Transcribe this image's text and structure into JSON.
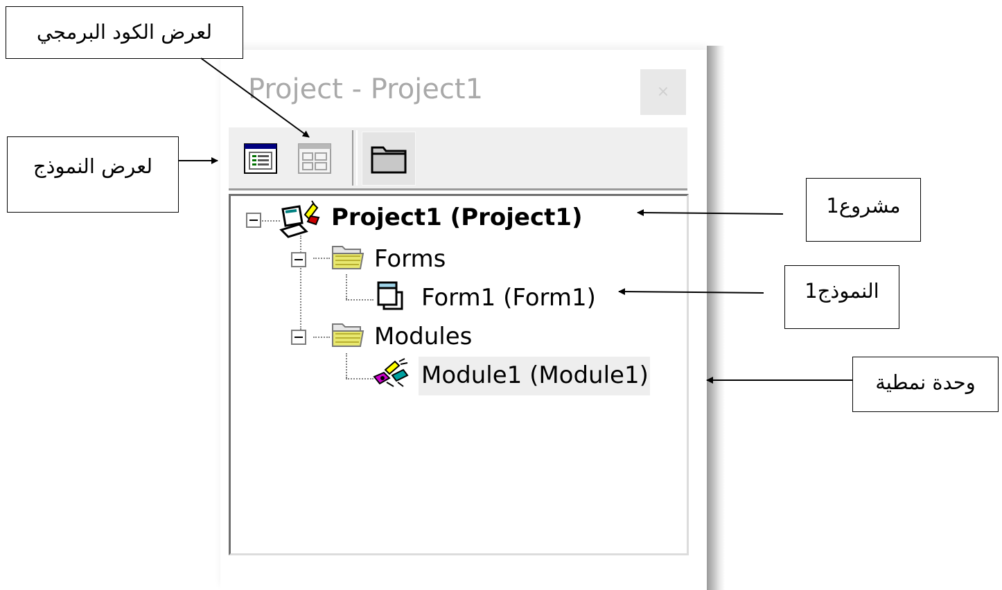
{
  "window": {
    "title": "Project - Project1",
    "close_label": "×"
  },
  "toolbar": {
    "view_object_icon": "view-object-icon",
    "view_code_icon": "view-code-icon",
    "toggle_folders_icon": "folder-icon"
  },
  "tree": {
    "project_label": "Project1 (Project1)",
    "forms_label": "Forms",
    "form1_label": "Form1 (Form1)",
    "modules_label": "Modules",
    "module1_label": "Module1 (Module1)"
  },
  "annotations": {
    "view_code": "لعرض الكود البرمجي",
    "view_form": "لعرض النموذج",
    "project1": "مشروع1",
    "form1": "النموذج1",
    "module": "وحدة نمطية"
  }
}
